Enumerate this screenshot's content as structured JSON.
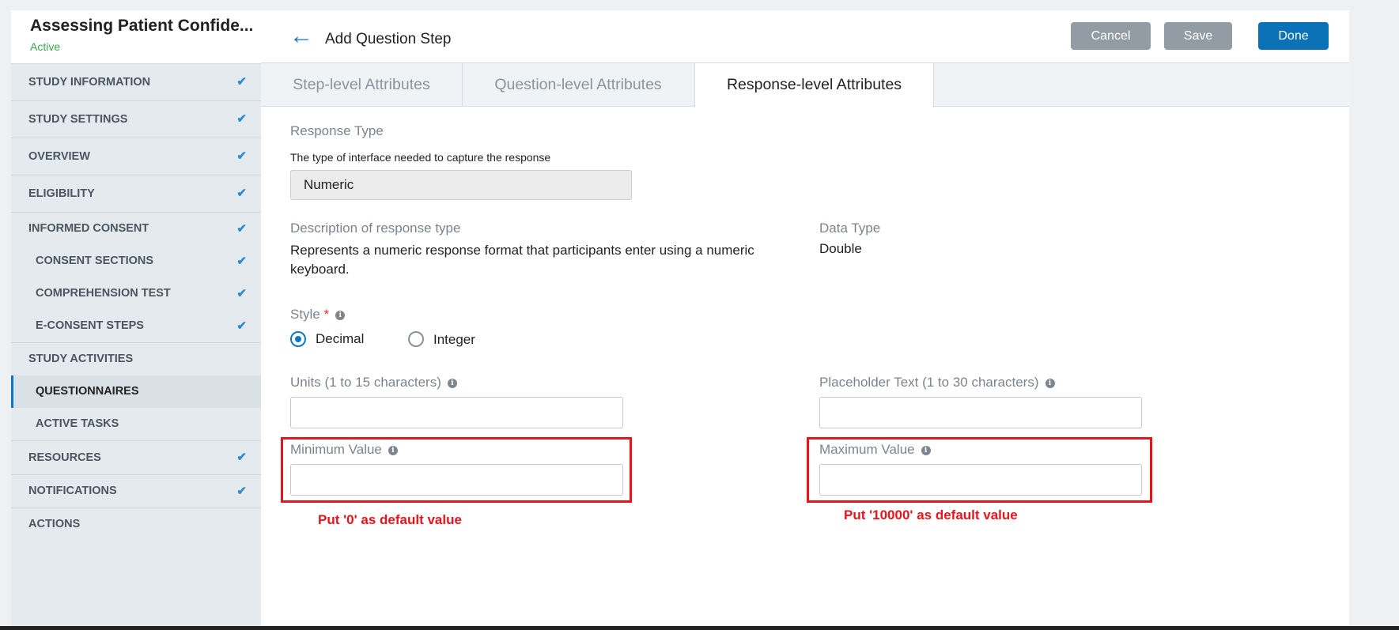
{
  "sidebar": {
    "study_title": "Assessing Patient Confide...",
    "study_status": "Active",
    "items": [
      {
        "label": "STUDY INFORMATION",
        "checked": true
      },
      {
        "label": "STUDY SETTINGS",
        "checked": true
      },
      {
        "label": "OVERVIEW",
        "checked": true
      },
      {
        "label": "ELIGIBILITY",
        "checked": true
      },
      {
        "label": "INFORMED CONSENT",
        "checked": true
      },
      {
        "label": "CONSENT SECTIONS",
        "checked": true
      },
      {
        "label": "COMPREHENSION TEST",
        "checked": true
      },
      {
        "label": "E-CONSENT STEPS",
        "checked": true
      },
      {
        "label": "STUDY ACTIVITIES",
        "checked": false
      },
      {
        "label": "QUESTIONNAIRES",
        "checked": false,
        "active": true
      },
      {
        "label": "ACTIVE TASKS",
        "checked": false
      },
      {
        "label": "RESOURCES",
        "checked": true
      },
      {
        "label": "NOTIFICATIONS",
        "checked": true
      },
      {
        "label": "ACTIONS",
        "checked": false
      }
    ]
  },
  "header": {
    "title": "Add Question Step",
    "cancel_label": "Cancel",
    "save_label": "Save",
    "done_label": "Done"
  },
  "tabs": [
    {
      "label": "Step-level Attributes"
    },
    {
      "label": "Question-level Attributes"
    },
    {
      "label": "Response-level Attributes",
      "active": true
    }
  ],
  "form": {
    "response_type_label": "Response Type",
    "response_type_help": "The type of interface needed to capture the response",
    "response_type_value": "Numeric",
    "description_label": "Description of response type",
    "description_value": "Represents a numeric response format that participants enter using a numeric keyboard.",
    "data_type_label": "Data Type",
    "data_type_value": "Double",
    "style_label": "Style",
    "style_required": "*",
    "style_options": [
      {
        "label": "Decimal",
        "selected": true
      },
      {
        "label": "Integer",
        "selected": false
      }
    ],
    "units_label": "Units (1 to 15 characters)",
    "placeholder_label": "Placeholder Text (1 to 30 characters)",
    "min_label": "Minimum Value",
    "max_label": "Maximum Value",
    "units_value": "",
    "placeholder_value": "",
    "min_value": "",
    "max_value": ""
  },
  "annotations": {
    "min_note": "Put '0' as default value",
    "max_note": "Put '10000' as default value",
    "highlight_color": "#e8131b"
  },
  "icons": {
    "check": "✔",
    "info": "i",
    "back": "←"
  },
  "colors": {
    "accent": "#0b79bf",
    "status_active": "#38a94d",
    "button_gray": "#939ca4"
  }
}
